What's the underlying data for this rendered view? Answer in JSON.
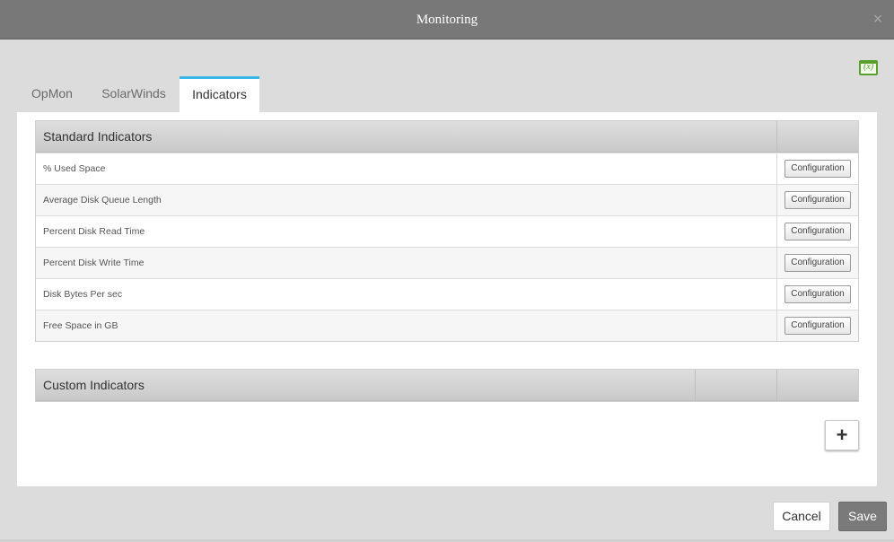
{
  "window": {
    "title": "Monitoring",
    "close_symbol": "×",
    "variables_icon_text": "(x)"
  },
  "tabs": [
    {
      "label": "OpMon",
      "active": false
    },
    {
      "label": "SolarWinds",
      "active": false
    },
    {
      "label": "Indicators",
      "active": true
    }
  ],
  "standard_indicators": {
    "title": "Standard Indicators",
    "rows": [
      {
        "label": "% Used Space",
        "button": "Configuration"
      },
      {
        "label": "Average Disk Queue Length",
        "button": "Configuration"
      },
      {
        "label": "Percent Disk Read Time",
        "button": "Configuration"
      },
      {
        "label": "Percent Disk Write Time",
        "button": "Configuration"
      },
      {
        "label": "Disk Bytes Per sec",
        "button": "Configuration"
      },
      {
        "label": "Free Space in GB",
        "button": "Configuration"
      }
    ]
  },
  "custom_indicators": {
    "title": "Custom Indicators",
    "add_symbol": "+"
  },
  "footer": {
    "cancel_label": "Cancel",
    "save_label": "Save"
  },
  "colors": {
    "titlebar": "#787878",
    "active_tab_accent": "#3bb6e8",
    "variables_icon": "#5aa02c",
    "save_button": "#7a7a7a"
  }
}
